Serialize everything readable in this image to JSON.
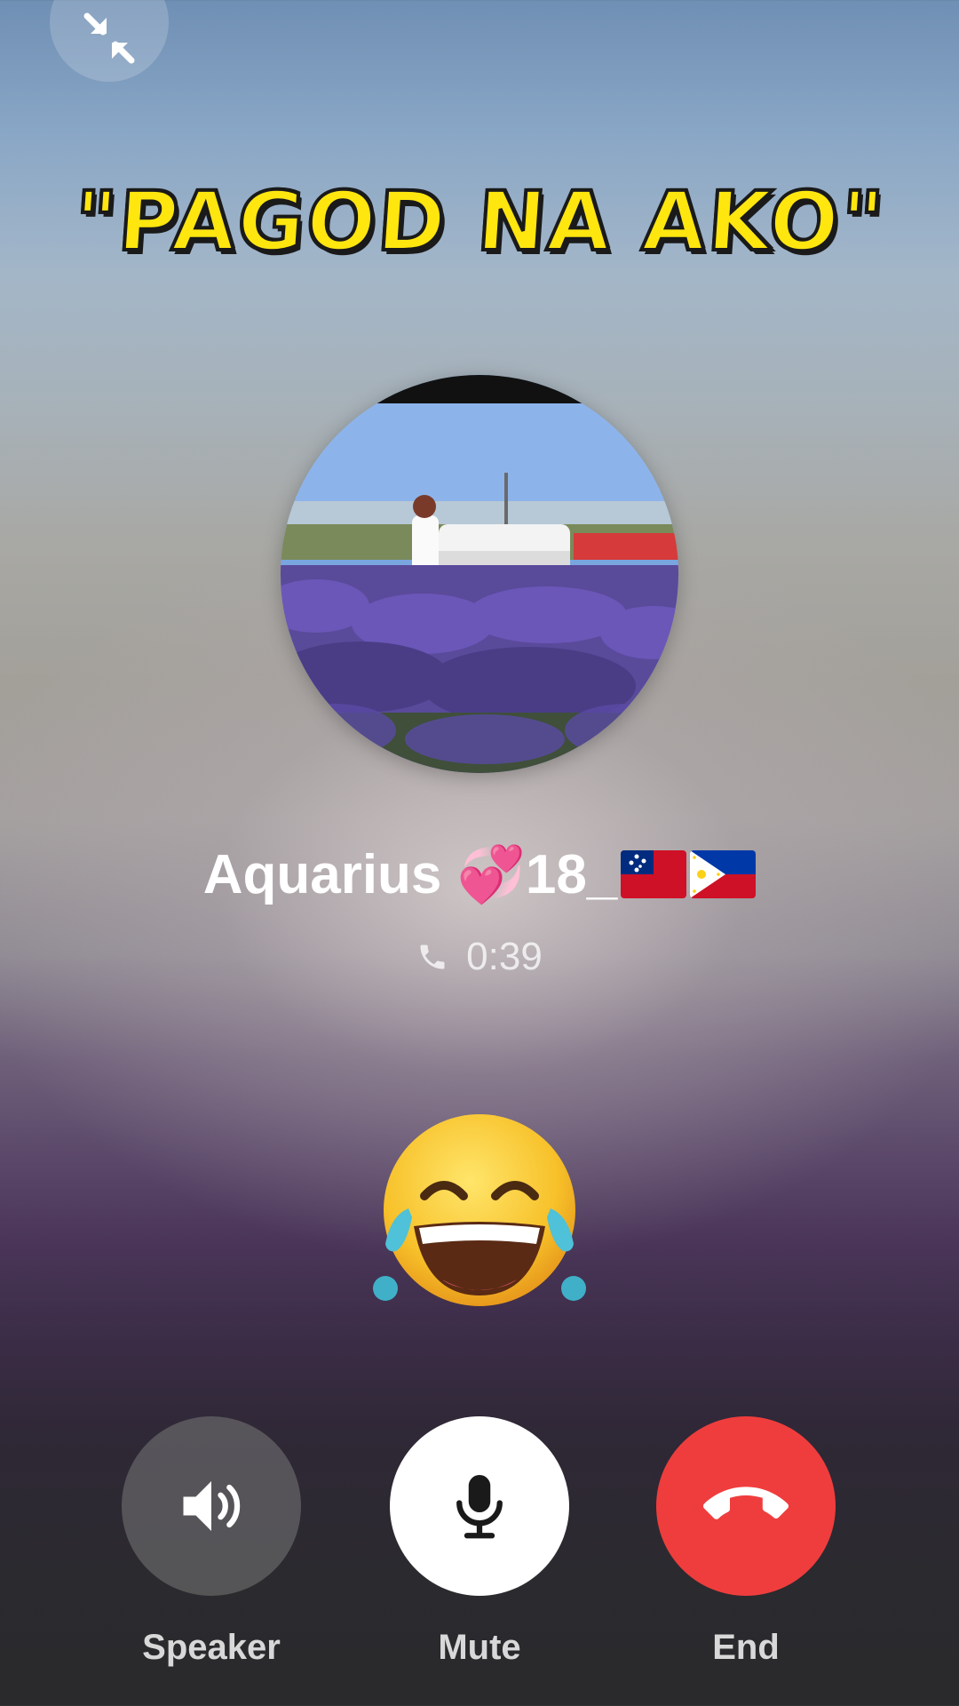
{
  "caption": "\"PAGOD NA AKO\"",
  "caller": {
    "name": "Aquarius",
    "heart_emoji": "💞",
    "suffix": "18_"
  },
  "call": {
    "duration": "0:39"
  },
  "reaction_emoji": "face-with-tears-of-joy",
  "controls": {
    "speaker_label": "Speaker",
    "mute_label": "Mute",
    "end_label": "End"
  },
  "colors": {
    "caption_yellow": "#ffe60f",
    "end_red": "#ef3d3d",
    "mute_white": "#ffffff"
  },
  "icons": [
    "minimize-icon",
    "phone-icon",
    "speaker-icon",
    "microphone-icon",
    "hang-up-icon",
    "samoa-flag-icon",
    "philippines-flag-icon"
  ]
}
